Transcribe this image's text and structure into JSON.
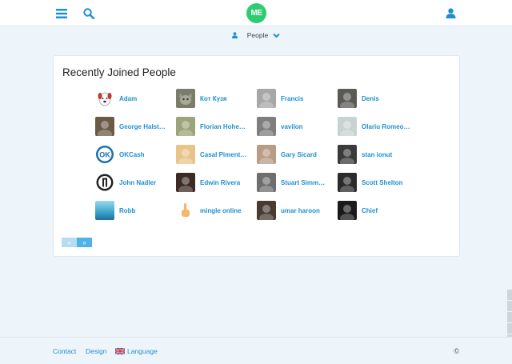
{
  "topbar": {
    "logo_text": "ME",
    "icons": [
      "menu-icon",
      "search-icon",
      "user-icon"
    ],
    "accent": "#1f8fd0",
    "logo_color": "#2ecc71"
  },
  "subnav": {
    "label": "People",
    "icons": [
      "person-icon",
      "chevron-down-icon"
    ]
  },
  "panel": {
    "title": "Recently Joined People",
    "people": [
      {
        "name": "Adam",
        "avatar": "dog",
        "color": "#ffffff"
      },
      {
        "name": "Кот Кузя",
        "avatar": "cat",
        "color": "#8d8d7a"
      },
      {
        "name": "Francis",
        "avatar": "photo",
        "color": "#a7a7a7"
      },
      {
        "name": "Denis",
        "avatar": "photo",
        "color": "#5b5a55"
      },
      {
        "name": "George Halst…",
        "avatar": "photo",
        "color": "#6b5a45"
      },
      {
        "name": "Florian Hohe…",
        "avatar": "photo",
        "color": "#9da37a"
      },
      {
        "name": "vavilon",
        "avatar": "photo",
        "color": "#7e7e7e"
      },
      {
        "name": "Olariu Romeo…",
        "avatar": "photo",
        "color": "#c8d2d0"
      },
      {
        "name": "OKCash",
        "avatar": "okcash",
        "color": "#1b6fae"
      },
      {
        "name": "Casal Piment…",
        "avatar": "photo",
        "color": "#e9c48a"
      },
      {
        "name": "Gary Sicard",
        "avatar": "photo",
        "color": "#b89c86"
      },
      {
        "name": "stan ionut",
        "avatar": "photo",
        "color": "#3a3a3a"
      },
      {
        "name": "John Nadler",
        "avatar": "badge",
        "color": "#222222"
      },
      {
        "name": "Edwin Rivera",
        "avatar": "photo",
        "color": "#3c2a24"
      },
      {
        "name": "Stuart Simm…",
        "avatar": "photo",
        "color": "#6e6e6e"
      },
      {
        "name": "Scott Shelton",
        "avatar": "photo",
        "color": "#2b2b2b"
      },
      {
        "name": "Robb",
        "avatar": "sky",
        "color": "#3aa3c9"
      },
      {
        "name": "mingle online",
        "avatar": "hand",
        "color": "#ffffff"
      },
      {
        "name": "umar haroon",
        "avatar": "photo",
        "color": "#4a3b32"
      },
      {
        "name": "Chief",
        "avatar": "photo",
        "color": "#1a1a1a"
      }
    ],
    "pager": {
      "prev": "«",
      "next": "»"
    }
  },
  "footer": {
    "contact": "Contact",
    "design": "Design",
    "language": "Language",
    "copyright": "©"
  }
}
